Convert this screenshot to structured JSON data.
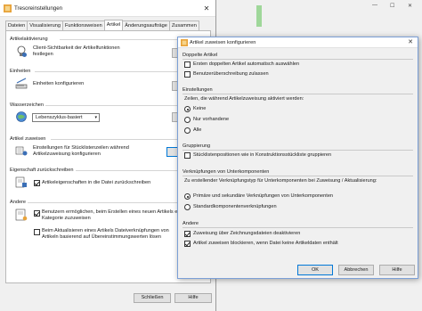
{
  "main_window": {
    "title": "Tresoreinstellungen",
    "close_glyph": "✕",
    "tabs": [
      {
        "label": "Dateien"
      },
      {
        "label": "Visualisierung"
      },
      {
        "label": "Funktionsweisen"
      },
      {
        "label": "Artikel"
      },
      {
        "label": "Änderungsaufträge"
      },
      {
        "label": "Zusammen"
      }
    ],
    "active_tab": "Artikel",
    "sections": {
      "artikelaktivierung": {
        "heading": "Artikelaktivierung",
        "text": "Client-Sichtbarkeit der Artikelfunktionen festlegen",
        "button": "Ko"
      },
      "einheiten": {
        "heading": "Einheiten",
        "text": "Einheiten konfigurieren",
        "button": "Ko"
      },
      "wasserzeichen": {
        "heading": "Wasserzeichen",
        "combo_value": "Lebenszyklus-basiert",
        "button": "Ko"
      },
      "artikel_zuweisen": {
        "heading": "Artikel zuweisen",
        "text": "Einstellungen für Stücklistenzeilen während Artikelzuweisung konfigurieren",
        "button": "Ko"
      },
      "eigenschaft": {
        "heading": "Eigenschaft zurückschreiben",
        "checkbox_label": "Artikeleigenschaften in die Datei zurückschreiben"
      },
      "andere": {
        "heading": "Andere",
        "item1": "Benutzern ermöglichen, beim Erstellen eines neuen Artikels ein Kategorie zuzuweisen",
        "item2": "Beim Aktualisieren eines Artikels Dateiverknüpfungen von Artikeln basierend auf Übereinstimmungswerten lösen"
      }
    },
    "buttons": {
      "close": "Schließen",
      "help": "Hilfe"
    }
  },
  "dialog": {
    "title": "Artikel zuweisen konfigurieren",
    "close_glyph": "✕",
    "doppelte": {
      "heading": "Doppelte Artikel",
      "opt1": "Ersten doppelten Artikel automatisch auswählen",
      "opt2": "Benutzerüberschreibung zulassen"
    },
    "einstellungen": {
      "heading": "Einstellungen",
      "prompt": "Zeilen, die während Artikelzuweisung aktiviert werden:",
      "options": [
        "Keine",
        "Nur vorhandene",
        "Alle"
      ],
      "selected": "Keine"
    },
    "gruppierung": {
      "heading": "Gruppierung",
      "opt": "Stücklistenpositionen wie in Konstruktionsstückliste gruppieren"
    },
    "verknuepfungen": {
      "heading": "Verknüpfungen von Unterkomponenten",
      "prompt": "Zu erstellender Verknüpfungstyp für Unterkomponenten bei Zuweisung / Aktualisierung:",
      "options": [
        "Primäre und sekundäre Verknüpfungen von Unterkomponenten",
        "Standardkomponentenverknüpfungen"
      ],
      "selected": "Primäre und sekundäre Verknüpfungen von Unterkomponenten"
    },
    "andere": {
      "heading": "Andere",
      "opt1": "Zuweisung über Zeichnungsdateien deaktivieren",
      "opt2": "Artikel zuweisen blockieren, wenn Datei keine Artikeldaten enthält"
    },
    "buttons": {
      "ok": "OK",
      "cancel": "Abbrechen",
      "help": "Hilfe"
    }
  },
  "colors": {
    "accent": "#0078d7",
    "green_strip": "#9fd79a"
  }
}
